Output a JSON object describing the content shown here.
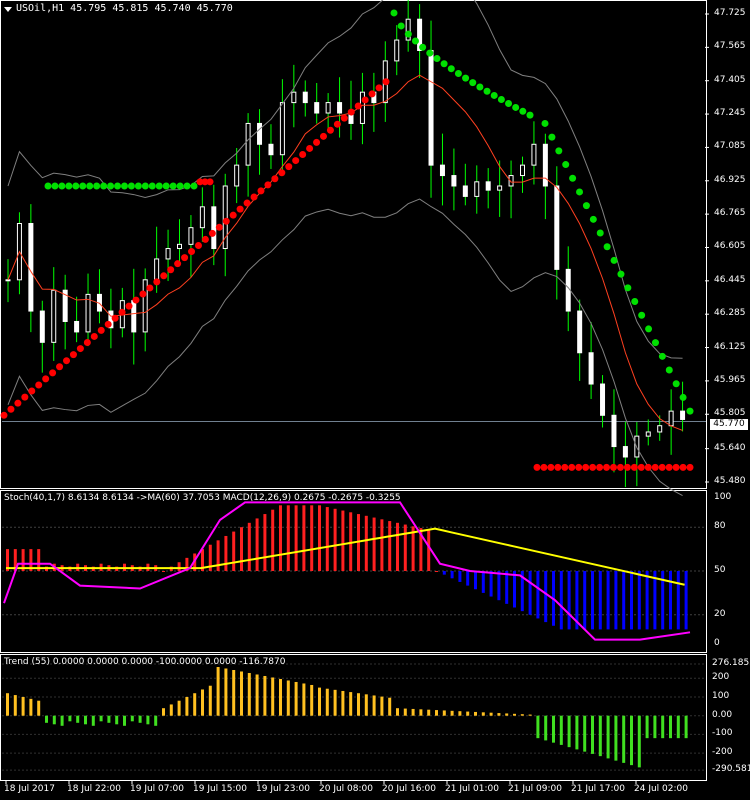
{
  "header": {
    "symbol_info": "USOil,H1  45.795 45.815 45.740 45.770"
  },
  "price_panel": {
    "current_price": "45.770",
    "axis_labels": [
      "47.725",
      "47.565",
      "47.405",
      "47.245",
      "47.085",
      "46.925",
      "46.765",
      "46.605",
      "46.445",
      "46.285",
      "46.125",
      "45.965",
      "45.805",
      "45.640",
      "45.480"
    ]
  },
  "stoch_panel": {
    "title": "Stoch(40,1,7) 8.6134 8.6134  ->MA(60) 37.7053  MACD(12,26,9) 0.2675 -0.2675 -0.3255",
    "axis_labels": [
      "100",
      "80",
      "50",
      "20",
      "0"
    ]
  },
  "trend_panel": {
    "title": "Trend (55) 0.0000 0.0000 0.0000 -100.0000 0.0000 -116.7870",
    "axis_labels": [
      "276.1853",
      "200",
      "100",
      "0.00",
      "-100",
      "-200",
      "-290.581"
    ]
  },
  "time_axis": [
    "18 Jul 2017",
    "18 Jul 22:00",
    "19 Jul 07:00",
    "19 Jul 15:00",
    "19 Jul 23:00",
    "20 Jul 08:00",
    "20 Jul 16:00",
    "21 Jul 01:00",
    "21 Jul 09:00",
    "21 Jul 17:00",
    "24 Jul 02:00"
  ],
  "colors": {
    "background": "#000000",
    "candle": "#ffffff",
    "wick": "#00ff00",
    "sar_up": "#00e000",
    "sar_down": "#ff0000",
    "ma_line": "#ff4020",
    "bands": "#808080",
    "hist_red": "#ff2020",
    "hist_blue": "#0000ff",
    "stoch_line": "#ff00ff",
    "ma_yellow": "#ffff00",
    "trend_gold": "#ffc020",
    "trend_green": "#40e020"
  },
  "chart_data": {
    "type": "candlestick",
    "title": "USOil,H1",
    "ylim": [
      45.48,
      47.725
    ],
    "close_path": [
      46.45,
      46.72,
      46.3,
      46.15,
      46.4,
      46.25,
      46.2,
      46.38,
      46.3,
      46.22,
      46.35,
      46.2,
      46.45,
      46.55,
      46.6,
      46.62,
      46.7,
      46.8,
      46.6,
      46.9,
      47.0,
      47.2,
      47.1,
      47.05,
      47.3,
      47.35,
      47.3,
      47.25,
      47.3,
      47.25,
      47.2,
      47.35,
      47.3,
      47.5,
      47.6,
      47.7,
      47.55,
      47.0,
      46.95,
      46.9,
      46.85,
      46.92,
      46.88,
      46.9,
      46.95,
      47.0,
      47.1,
      46.9,
      46.5,
      46.3,
      46.1,
      45.95,
      45.8,
      45.65,
      45.6,
      45.7,
      45.72,
      45.75,
      45.82,
      45.78
    ],
    "sar_green": [
      [
        46.9,
        46.9
      ],
      [
        47.73,
        47.24
      ],
      [
        47.2,
        45.82
      ]
    ],
    "sar_red": [
      [
        45.8,
        47.4
      ],
      [
        46.92,
        46.92
      ],
      [
        45.55,
        45.55
      ]
    ]
  }
}
